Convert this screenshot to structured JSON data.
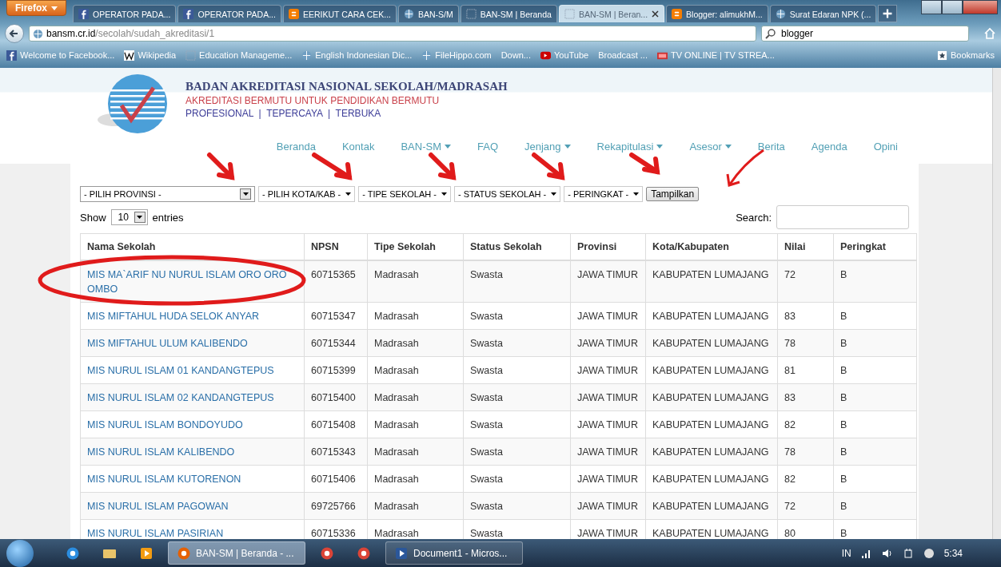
{
  "browser": {
    "menu_button": "Firefox",
    "tabs": [
      {
        "label": "OPERATOR PADA...",
        "kind": "facebook",
        "selected": false
      },
      {
        "label": "OPERATOR PADA...",
        "kind": "facebook",
        "selected": false
      },
      {
        "label": "EERIKUT CARA CEK...",
        "kind": "blogger",
        "selected": false
      },
      {
        "label": "BAN-S/M",
        "kind": "globe",
        "selected": false
      },
      {
        "label": "BAN-SM | Beranda",
        "kind": "page",
        "selected": false
      },
      {
        "label": "BAN-SM | Beran...",
        "kind": "page",
        "selected": true
      },
      {
        "label": "Blogger: alimukhM...",
        "kind": "blogger",
        "selected": false
      },
      {
        "label": "Surat Edaran NPK (...",
        "kind": "globe",
        "selected": false
      }
    ],
    "address": {
      "host": "bansm.cr.id",
      "path": "/secolah/sudah_akreditasi/1"
    },
    "search": {
      "value": "blogger"
    },
    "bookmarks": [
      {
        "label": "Welcome to Facebook...",
        "kind": "facebook"
      },
      {
        "label": "Wikipedia",
        "kind": "wiki"
      },
      {
        "label": "Education Manageme...",
        "kind": "page"
      },
      {
        "label": "English Indonesian Dic...",
        "kind": "globe"
      },
      {
        "label": "FileHippo.com",
        "kind": "globe"
      },
      {
        "label": "Down...",
        "kind": "plain"
      },
      {
        "label": "YouTube",
        "kind": "youtube"
      },
      {
        "label": "Broadcast ...",
        "kind": "plain"
      },
      {
        "label": "TV ONLINE | TV STREA...",
        "kind": "tv"
      }
    ],
    "bookmarks_menu": "Bookmarks"
  },
  "site": {
    "title": "BADAN AKREDITASI NASIONAL SEKOLAH/MADRASAH",
    "tagline": "AKREDITASI BERMUTU UNTUK PENDIDIKAN BERMUTU",
    "motto": "PROFESIONAL  |  TEPERCAYA  |  TERBUKA",
    "nav": [
      {
        "label": "Beranda",
        "dropdown": false
      },
      {
        "label": "Kontak",
        "dropdown": false
      },
      {
        "label": "BAN-SM",
        "dropdown": true
      },
      {
        "label": "FAQ",
        "dropdown": false
      },
      {
        "label": "Jenjang",
        "dropdown": true
      },
      {
        "label": "Rekapitulasi",
        "dropdown": true
      },
      {
        "label": "Asesor",
        "dropdown": true
      },
      {
        "label": "Berita",
        "dropdown": false
      },
      {
        "label": "Agenda",
        "dropdown": false
      },
      {
        "label": "Opini",
        "dropdown": false
      }
    ],
    "filters": [
      {
        "label": "- PILIH PROVINSI -",
        "kind": "combo"
      },
      {
        "label": "- PILIH KOTA/KAB -",
        "kind": "select"
      },
      {
        "label": "- TIPE SEKOLAH -",
        "kind": "select"
      },
      {
        "label": "- STATUS SEKOLAH -",
        "kind": "select"
      },
      {
        "label": "- PERINGKAT -",
        "kind": "select"
      }
    ],
    "submit_button": "Tampilkan",
    "length": {
      "before": "Show",
      "value": "10",
      "after": "entries"
    },
    "search_label": "Search:",
    "table": {
      "columns": [
        "Nama Sekolah",
        "NPSN",
        "Tipe Sekolah",
        "Status Sekolah",
        "Provinsi",
        "Kota/Kabupaten",
        "Nilai",
        "Peringkat"
      ],
      "rows": [
        [
          "MIS MA`ARIF NU NURUL ISLAM ORO ORO OMBO",
          "60715365",
          "Madrasah",
          "Swasta",
          "JAWA TIMUR",
          "KABUPATEN LUMAJANG",
          "72",
          "B"
        ],
        [
          "MIS MIFTAHUL HUDA SELOK ANYAR",
          "60715347",
          "Madrasah",
          "Swasta",
          "JAWA TIMUR",
          "KABUPATEN LUMAJANG",
          "83",
          "B"
        ],
        [
          "MIS MIFTAHUL ULUM KALIBENDO",
          "60715344",
          "Madrasah",
          "Swasta",
          "JAWA TIMUR",
          "KABUPATEN LUMAJANG",
          "78",
          "B"
        ],
        [
          "MIS NURUL ISLAM 01 KANDANGTEPUS",
          "60715399",
          "Madrasah",
          "Swasta",
          "JAWA TIMUR",
          "KABUPATEN LUMAJANG",
          "81",
          "B"
        ],
        [
          "MIS NURUL ISLAM 02 KANDANGTEPUS",
          "60715400",
          "Madrasah",
          "Swasta",
          "JAWA TIMUR",
          "KABUPATEN LUMAJANG",
          "83",
          "B"
        ],
        [
          "MIS NURUL ISLAM BONDOYUDO",
          "60715408",
          "Madrasah",
          "Swasta",
          "JAWA TIMUR",
          "KABUPATEN LUMAJANG",
          "82",
          "B"
        ],
        [
          "MIS NURUL ISLAM KALIBENDO",
          "60715343",
          "Madrasah",
          "Swasta",
          "JAWA TIMUR",
          "KABUPATEN LUMAJANG",
          "78",
          "B"
        ],
        [
          "MIS NURUL ISLAM KUTORENON",
          "60715406",
          "Madrasah",
          "Swasta",
          "JAWA TIMUR",
          "KABUPATEN LUMAJANG",
          "82",
          "B"
        ],
        [
          "MIS NURUL ISLAM PAGOWAN",
          "69725766",
          "Madrasah",
          "Swasta",
          "JAWA TIMUR",
          "KABUPATEN LUMAJANG",
          "72",
          "B"
        ],
        [
          "MIS NURUL ISLAM PASIRIAN",
          "60715336",
          "Madrasah",
          "Swasta",
          "JAWA TIMUR",
          "KABUPATEN LUMAJANG",
          "80",
          "B"
        ]
      ]
    }
  },
  "taskbar": {
    "items": [
      {
        "kind": "ie",
        "selected": false
      },
      {
        "kind": "folder",
        "selected": false
      },
      {
        "kind": "media",
        "selected": false
      },
      {
        "kind": "firefox",
        "label": "BAN-SM | Beranda - ...",
        "selected": true
      },
      {
        "kind": "chrome",
        "selected": false
      },
      {
        "kind": "chrome",
        "selected": false
      },
      {
        "kind": "word",
        "label": "Document1 - Micros...",
        "selected": false
      }
    ],
    "language": "IN",
    "time": "5:34"
  }
}
